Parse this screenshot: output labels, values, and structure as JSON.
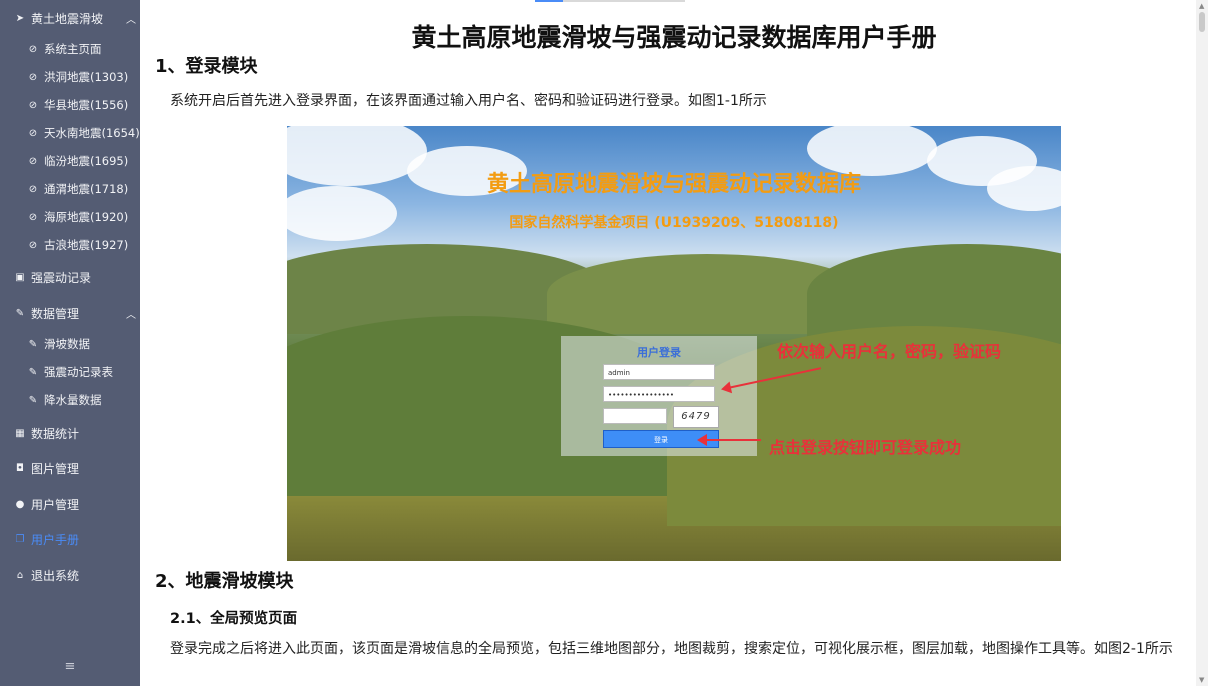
{
  "sidebar": {
    "header": {
      "label": "黄土地震滑坡"
    },
    "quake_items": [
      {
        "label": "系统主页面"
      },
      {
        "label": "洪洞地震(1303)"
      },
      {
        "label": "华县地震(1556)"
      },
      {
        "label": "天水南地震(1654)"
      },
      {
        "label": "临汾地震(1695)"
      },
      {
        "label": "通渭地震(1718)"
      },
      {
        "label": "海原地震(1920)"
      },
      {
        "label": "古浪地震(1927)"
      }
    ],
    "strong_record": {
      "label": "强震动记录"
    },
    "data_mgmt": {
      "label": "数据管理",
      "items": [
        {
          "label": "滑坡数据"
        },
        {
          "label": "强震动记录表"
        },
        {
          "label": "降水量数据"
        }
      ]
    },
    "stats": {
      "label": "数据统计"
    },
    "images": {
      "label": "图片管理"
    },
    "users": {
      "label": "用户管理"
    },
    "manual": {
      "label": "用户手册"
    },
    "logout": {
      "label": "退出系统"
    },
    "active_color": "#4a8cf7"
  },
  "doc": {
    "title": "黄土高原地震滑坡与强震动记录数据库用户手册",
    "section1": {
      "heading": "1、登录模块",
      "text": "系统开启后首先进入登录界面，在该界面通过输入用户名、密码和验证码进行登录。如图1-1所示"
    },
    "figure": {
      "title": "黄土高原地震滑坡与强震动记录数据库",
      "subtitle": "国家自然科学基金项目 (U1939209、51808118)",
      "login": {
        "title": "用户登录",
        "username": "admin",
        "password": "••••••••••••••••",
        "captcha": "6479",
        "button": "登录"
      },
      "annotation1": "依次输入用户名，密码，验证码",
      "annotation2": "点击登录按钮即可登录成功"
    },
    "section2": {
      "heading": "2、地震滑坡模块",
      "sub": "2.1、全局预览页面",
      "text": "登录完成之后将进入此页面，该页面是滑坡信息的全局预览，包括三维地图部分，地图裁剪，搜索定位，可视化展示框，图层加载，地图操作工具等。如图2-1所示"
    }
  }
}
